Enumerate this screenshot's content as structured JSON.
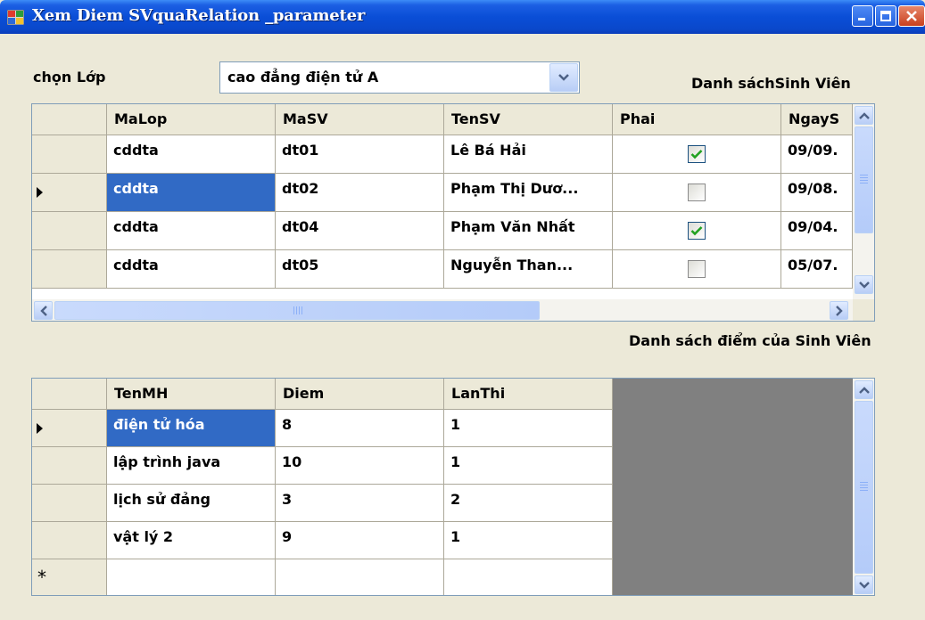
{
  "window": {
    "title": "Xem Diem SVquaRelation _parameter",
    "icons": [
      "app-icon",
      "minimize-icon",
      "maximize-icon",
      "close-icon"
    ]
  },
  "filter": {
    "label": "chọn Lớp",
    "selected_class": "cao đẳng điện tử A",
    "students_caption": "Danh sáchSinh Viên",
    "scores_caption": "Danh sách điểm của Sinh Viên"
  },
  "students_grid": {
    "columns": [
      "MaLop",
      "MaSV",
      "TenSV",
      "Phai",
      "NgayS"
    ],
    "rows": [
      {
        "malop": "cddta",
        "masv": "dt01",
        "tensv": "Lê Bá Hải",
        "phai": true,
        "ngays": "09/09."
      },
      {
        "malop": "cddta",
        "masv": "dt02",
        "tensv": "Phạm Thị Dươ...",
        "phai": false,
        "ngays": "09/08."
      },
      {
        "malop": "cddta",
        "masv": "dt04",
        "tensv": "Phạm Văn Nhất",
        "phai": true,
        "ngays": "09/04."
      },
      {
        "malop": "cddta",
        "masv": "dt05",
        "tensv": "Nguyễn Than...",
        "phai": false,
        "ngays": "05/07."
      }
    ],
    "current_row": 1
  },
  "scores_grid": {
    "columns": [
      "TenMH",
      "Diem",
      "LanThi"
    ],
    "rows": [
      {
        "tenmh": "điện tử hóa",
        "diem": "8",
        "lanthi": "1"
      },
      {
        "tenmh": "lập trình java",
        "diem": "10",
        "lanthi": "1"
      },
      {
        "tenmh": "lịch sử đảng",
        "diem": "3",
        "lanthi": "2"
      },
      {
        "tenmh": "vật lý 2",
        "diem": "9",
        "lanthi": "1"
      }
    ],
    "current_row": 0,
    "new_row_marker": "*"
  },
  "colors": {
    "titlebar": "#0a4ed7",
    "selection": "#316ac5",
    "window_bg": "#ece9d8",
    "grid_background": "#808080"
  }
}
